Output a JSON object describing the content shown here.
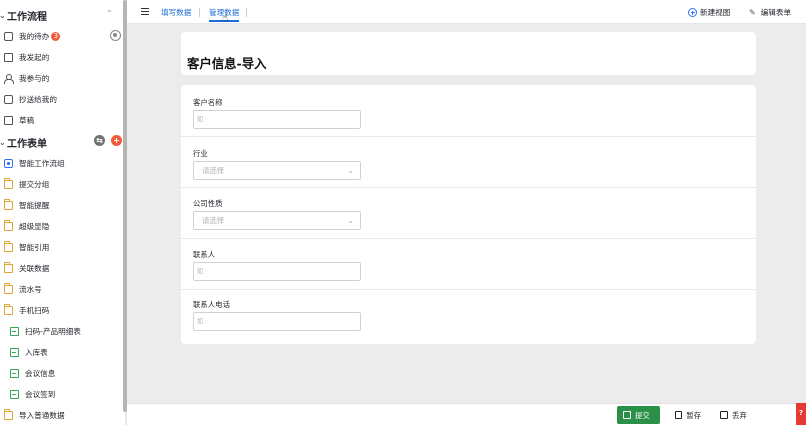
{
  "sidebar": {
    "section1_title": "工作流程",
    "workflow_items": [
      {
        "label": "我的待办",
        "badge": "3",
        "icon": "todo-icon"
      },
      {
        "label": "我发起的",
        "icon": "initiated-icon"
      },
      {
        "label": "我参与的",
        "icon": "participant-icon"
      },
      {
        "label": "抄送给我的",
        "icon": "cc-icon"
      },
      {
        "label": "草稿",
        "icon": "draft-icon"
      }
    ],
    "section2_title": "工作表单",
    "add_symbol": "+",
    "group_symbol": "⇆",
    "form_items": [
      {
        "label": "智能工作流组",
        "icon": "smart-flow-icon"
      },
      {
        "label": "提交分组",
        "icon": "folder-icon"
      },
      {
        "label": "智能提醒",
        "icon": "folder-icon"
      },
      {
        "label": "超级显隐",
        "icon": "folder-icon"
      },
      {
        "label": "智能引用",
        "icon": "folder-icon"
      },
      {
        "label": "关联数据",
        "icon": "folder-icon"
      },
      {
        "label": "流水号",
        "icon": "folder-icon"
      },
      {
        "label": "手机扫码",
        "icon": "folder-icon"
      }
    ],
    "sub_items": [
      {
        "label": "扫码-产品明细表",
        "icon": "form-doc-icon"
      },
      {
        "label": "入库表",
        "icon": "form-doc-icon"
      },
      {
        "label": "会议信息",
        "icon": "form-doc-icon"
      },
      {
        "label": "会议签到",
        "icon": "form-doc-icon"
      }
    ],
    "last_item": {
      "label": "导入普通数据",
      "icon": "folder-icon"
    }
  },
  "topbar": {
    "tabs": [
      {
        "label": "填写数据"
      },
      {
        "label": "管理数据"
      }
    ],
    "new_view": "新建视图",
    "edit_form": "编辑表单"
  },
  "form": {
    "title": "客户信息-导入",
    "fields": [
      {
        "label": "客户名称",
        "type": "input",
        "placeholder": "如"
      },
      {
        "label": "行业",
        "type": "select",
        "placeholder": "请选择"
      },
      {
        "label": "公司性质",
        "type": "select",
        "placeholder": "请选择"
      },
      {
        "label": "联系人",
        "type": "input",
        "placeholder": "如"
      },
      {
        "label": "联系人电话",
        "type": "input",
        "placeholder": "如"
      }
    ]
  },
  "actions": {
    "submit": "提交",
    "save": "暂存",
    "discard": "丢弃",
    "help": "?"
  },
  "colors": {
    "accent": "#1a6fd6",
    "submit": "#2a8f47",
    "badge": "#ef5b3b"
  }
}
